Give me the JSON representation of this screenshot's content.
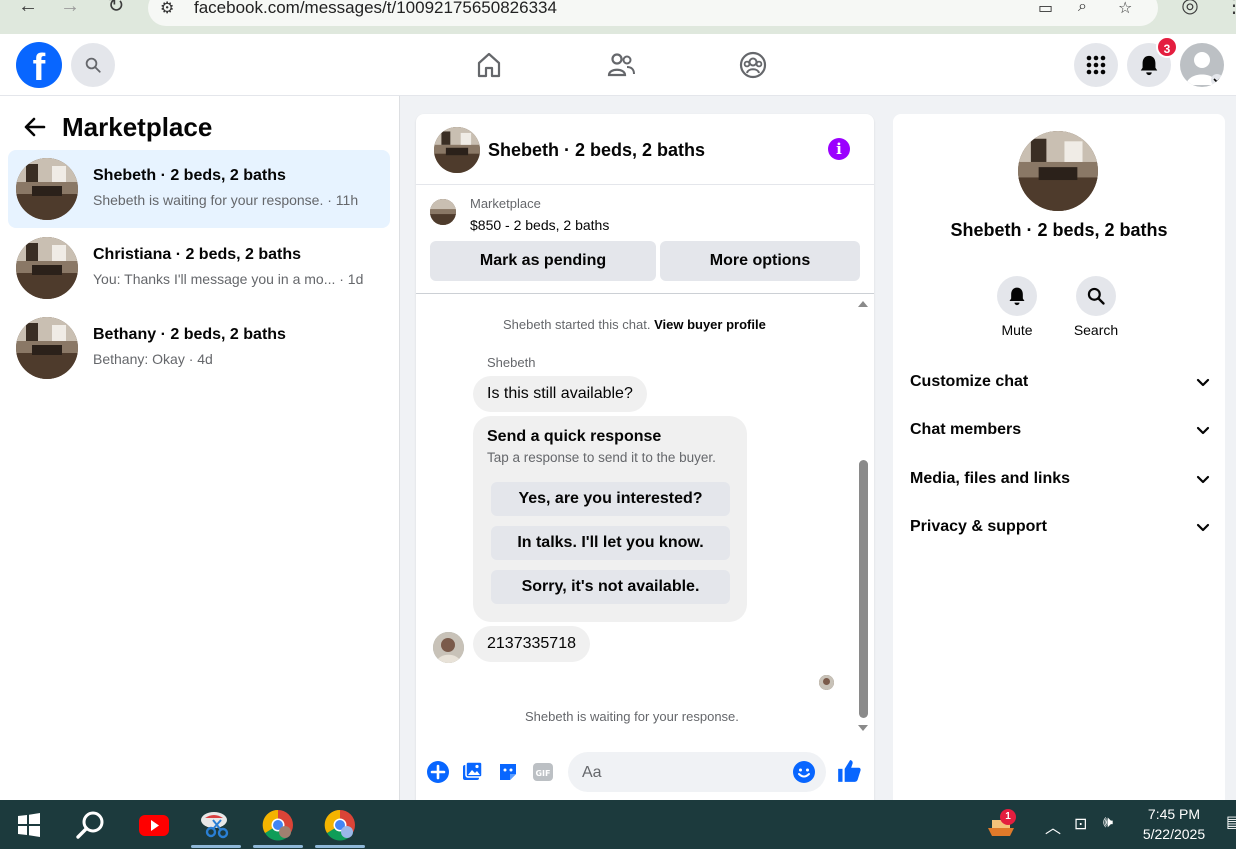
{
  "browser": {
    "url": "facebook.com/messages/t/10092175650826334"
  },
  "topnav": {
    "logo": "f",
    "notifications_count": "3"
  },
  "sidebar": {
    "title": "Marketplace",
    "conversations": [
      {
        "name": "Shebeth · 2 beds, 2 baths",
        "preview": "Shebeth is waiting for your response. · 11h",
        "active": true
      },
      {
        "name": "Christiana · 2 beds, 2 baths",
        "preview": "You: Thanks I'll message you in a mo...  · 1d",
        "active": false
      },
      {
        "name": "Bethany · 2 beds, 2 baths",
        "preview": "Bethany: Okay · 4d",
        "active": false
      }
    ]
  },
  "chat": {
    "title": "Shebeth · 2 beds, 2 baths",
    "marketplace_label": "Marketplace",
    "listing": "$850 - 2 beds, 2 baths",
    "mark_pending": "Mark as pending",
    "more_options": "More options",
    "started_text": "Shebeth started this chat.",
    "view_profile": "View buyer profile",
    "sender_name": "Shebeth",
    "message_1": "Is this still available?",
    "quick_title": "Send a quick response",
    "quick_sub": "Tap a response to send it to the buyer.",
    "quick_options": [
      "Yes, are you interested?",
      "In talks. I'll let you know.",
      "Sorry, it's not available."
    ],
    "message_2": "2137335718",
    "waiting_text": "Shebeth is waiting for your response.",
    "composer_placeholder": "Aa"
  },
  "details": {
    "name": "Shebeth · 2 beds, 2 baths",
    "mute": "Mute",
    "search": "Search",
    "sections": [
      "Customize chat",
      "Chat members",
      "Media, files and links",
      "Privacy & support"
    ]
  },
  "taskbar": {
    "time": "7:45 PM",
    "date": "5/22/2025",
    "tray_badge": "1"
  },
  "colors": {
    "accent": "#0866ff",
    "info": "#9b00ff",
    "badge": "#e41e3f",
    "taskbar": "#1c3a3d"
  }
}
